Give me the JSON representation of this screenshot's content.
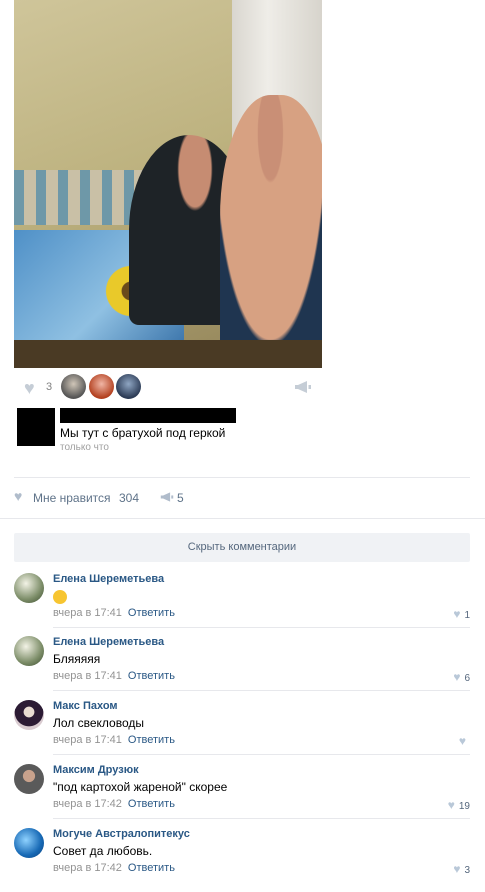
{
  "photo_card": {
    "likes_count": "3",
    "liker_avatars": [
      "avatar-1",
      "avatar-2",
      "avatar-3"
    ]
  },
  "caption": {
    "text": "Мы тут с братухой под геркой",
    "time": "только что"
  },
  "post_stats": {
    "like_label": "Мне нравится",
    "like_count": "304",
    "share_count": "5"
  },
  "hide_comments_label": "Скрыть комментарии",
  "comments": [
    {
      "name": "Елена Шереметьева",
      "text": "",
      "emoji": "laughing-emoji",
      "time": "вчера в 17:41",
      "reply": "Ответить",
      "likes": "1"
    },
    {
      "name": "Елена Шереметьева",
      "text": "Бляяяяя",
      "time": "вчера в 17:41",
      "reply": "Ответить",
      "likes": "6"
    },
    {
      "name": "Макс Пахом",
      "text": "Лол свекловоды",
      "time": "вчера в 17:41",
      "reply": "Ответить",
      "likes": ""
    },
    {
      "name": "Максим Друзюк",
      "text": "\"под картохой жареной\" скорее",
      "time": "вчера в 17:42",
      "reply": "Ответить",
      "likes": "19"
    },
    {
      "name": "Могуче Австралопитекус",
      "text": "Совет да любовь.",
      "time": "вчера в 17:42",
      "reply": "Ответить",
      "likes": "3"
    }
  ],
  "colors": {
    "link": "#2a5885",
    "muted": "#939393",
    "button_bg": "#f0f2f5"
  }
}
